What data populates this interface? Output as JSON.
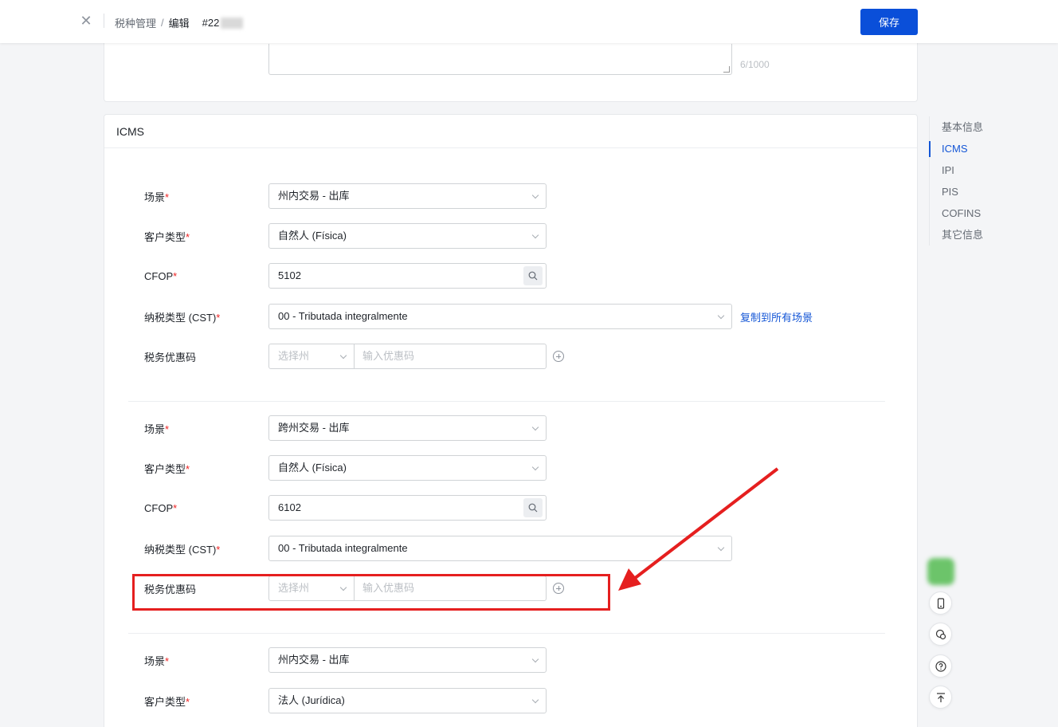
{
  "header": {
    "breadcrumb_root": "税种管理",
    "breadcrumb_sep": "/",
    "breadcrumb_current": "编辑",
    "record_code": "#22",
    "save_label": "保存"
  },
  "top_card": {
    "counter": "6/1000"
  },
  "icms": {
    "title": "ICMS",
    "copy_link": "复制到所有场景",
    "groups": [
      {
        "scene_label": "场景",
        "scene": "州内交易 - 出库",
        "customer_label": "客户类型",
        "customer": "自然人 (Física)",
        "cfop_label": "CFOP",
        "cfop": "5102",
        "cst_label": "纳税类型 (CST)",
        "cst": "00 - Tributada integralmente",
        "benefit_label": "税务优惠码",
        "state_placeholder": "选择州",
        "code_placeholder": "输入优惠码"
      },
      {
        "scene_label": "场景",
        "scene": "跨州交易 - 出库",
        "customer_label": "客户类型",
        "customer": "自然人 (Física)",
        "cfop_label": "CFOP",
        "cfop": "6102",
        "cst_label": "纳税类型 (CST)",
        "cst": "00 - Tributada integralmente",
        "benefit_label": "税务优惠码",
        "state_placeholder": "选择州",
        "code_placeholder": "输入优惠码"
      },
      {
        "scene_label": "场景",
        "scene": "州内交易 - 出库",
        "customer_label": "客户类型",
        "customer": "法人 (Jurídica)"
      }
    ]
  },
  "anchor_nav": [
    "基本信息",
    "ICMS",
    "IPI",
    "PIS",
    "COFINS",
    "其它信息"
  ],
  "colors": {
    "primary": "#0a4fd9",
    "link": "#1456d6",
    "required": "#e22",
    "annotation": "#e51f1f"
  }
}
